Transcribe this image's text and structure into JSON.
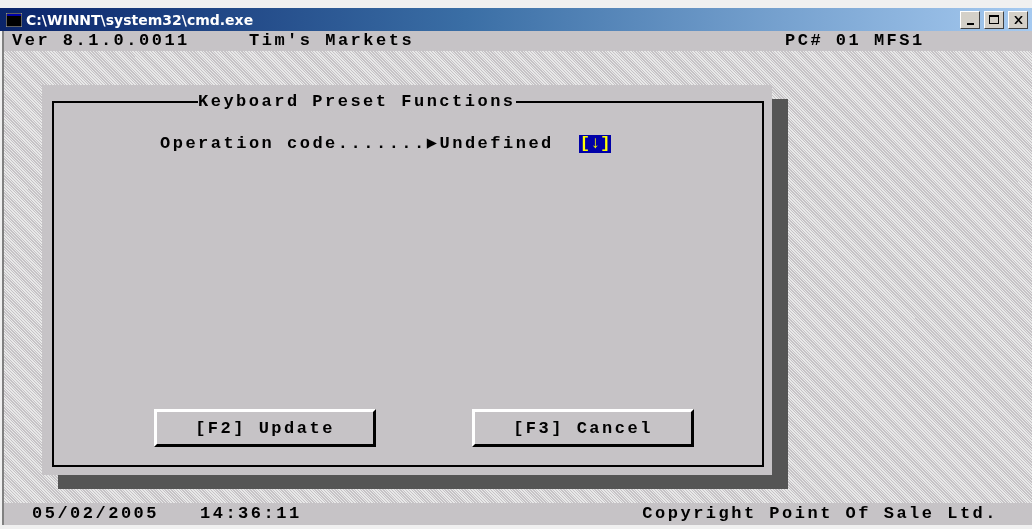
{
  "window": {
    "title": "C:\\WINNT\\system32\\cmd.exe"
  },
  "header": {
    "version": "Ver 8.1.0.0011",
    "store": "Tim's Markets",
    "terminal": "PC# 01 MFS1"
  },
  "dialog": {
    "title": "Keyboard Preset Functions",
    "fields": [
      {
        "label": "Operation code.......",
        "pointer": "▶",
        "value": "Undefined",
        "dropdown": "[↓]"
      }
    ],
    "buttons": [
      "[F2] Update",
      "[F3] Cancel"
    ]
  },
  "status_bar": {
    "date": "05/02/2005",
    "time": "14:36:11",
    "copyright": "Copyright Point Of Sale Ltd."
  }
}
